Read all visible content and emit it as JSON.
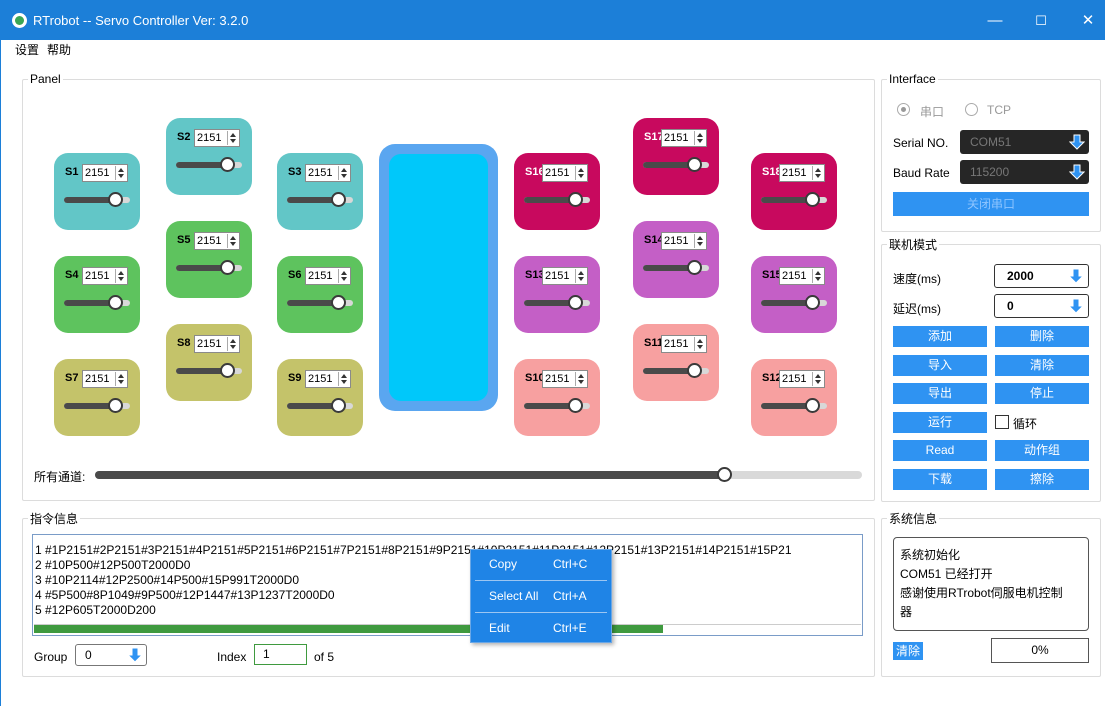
{
  "window": {
    "title": "RTrobot -- Servo Controller  Ver: 3.2.0",
    "minimize": "—",
    "maximize": "☐",
    "close": "✕"
  },
  "menu": {
    "items": [
      "设置",
      "帮助"
    ]
  },
  "panel": {
    "legend": "Panel",
    "all_channels_label": "所有通道:",
    "all_channels_value": 0.82,
    "servos": [
      {
        "id": "S1",
        "value": "2151",
        "color": "#62c6c7",
        "level": 0.78
      },
      {
        "id": "S2",
        "value": "2151",
        "color": "#62c6c7",
        "level": 0.78
      },
      {
        "id": "S3",
        "value": "2151",
        "color": "#62c6c7",
        "level": 0.78
      },
      {
        "id": "S4",
        "value": "2151",
        "color": "#5ec35e",
        "level": 0.78
      },
      {
        "id": "S5",
        "value": "2151",
        "color": "#5ec35e",
        "level": 0.78
      },
      {
        "id": "S6",
        "value": "2151",
        "color": "#5ec35e",
        "level": 0.78
      },
      {
        "id": "S7",
        "value": "2151",
        "color": "#c4c36a",
        "level": 0.78
      },
      {
        "id": "S8",
        "value": "2151",
        "color": "#c4c36a",
        "level": 0.78
      },
      {
        "id": "S9",
        "value": "2151",
        "color": "#c4c36a",
        "level": 0.78
      },
      {
        "id": "S10",
        "value": "2151",
        "color": "#f7a0a0",
        "level": 0.78
      },
      {
        "id": "S11",
        "value": "2151",
        "color": "#f7a0a0",
        "level": 0.78
      },
      {
        "id": "S12",
        "value": "2151",
        "color": "#f7a0a0",
        "level": 0.78
      },
      {
        "id": "S13",
        "value": "2151",
        "color": "#c45fc6",
        "level": 0.78
      },
      {
        "id": "S14",
        "value": "2151",
        "color": "#c45fc6",
        "level": 0.78
      },
      {
        "id": "S15",
        "value": "2151",
        "color": "#c45fc6",
        "level": 0.78
      },
      {
        "id": "S16",
        "value": "2151",
        "color": "#c8095e",
        "level": 0.78
      },
      {
        "id": "S17",
        "value": "2151",
        "color": "#c8095e",
        "level": 0.78
      },
      {
        "id": "S18",
        "value": "2151",
        "color": "#c8095e",
        "level": 0.78
      }
    ]
  },
  "interface": {
    "legend": "Interface",
    "radio_serial": "串口",
    "radio_tcp": "TCP",
    "serial_no_label": "Serial NO.",
    "serial_no_value": "COM51",
    "baud_label": "Baud Rate",
    "baud_value": "115200",
    "close_port": "关闭串口"
  },
  "linkage": {
    "legend": "联机模式",
    "speed_label": "速度(ms)",
    "speed_value": "2000",
    "delay_label": "延迟(ms)",
    "delay_value": "0",
    "buttons": {
      "add": "添加",
      "delete": "删除",
      "import": "导入",
      "clear": "清除",
      "export": "导出",
      "stop": "停止",
      "run": "运行",
      "loop": "循环",
      "read": "Read",
      "action_group": "动作组",
      "download": "下载",
      "erase": "擦除"
    }
  },
  "commands": {
    "legend": "指令信息",
    "lines": [
      "1 #1P2151#2P2151#3P2151#4P2151#5P2151#6P2151#7P2151#8P2151#9P2151#10P2151#11P2151#12P2151#13P2151#14P2151#15P21",
      "2 #10P500#12P500T2000D0",
      "3 #10P2114#12P2500#14P500#15P991T2000D0",
      "4 #5P500#8P1049#9P500#12P1447#13P1237T2000D0",
      "5 #12P605T2000D200"
    ],
    "progress": 0.76,
    "group_label": "Group",
    "group_value": "0",
    "index_label": "Index",
    "index_value": "1",
    "of_label": "of 5"
  },
  "context_menu": [
    {
      "label": "Copy",
      "shortcut": "Ctrl+C"
    },
    {
      "label": "Select All",
      "shortcut": "Ctrl+A"
    },
    {
      "label": "Edit",
      "shortcut": "Ctrl+E"
    }
  ],
  "system": {
    "legend": "系统信息",
    "messages": [
      "系统初始化",
      "COM51 已经打开",
      "感谢使用RTrobot伺服电机控制",
      "器"
    ],
    "clear": "清除",
    "percent": "0%"
  },
  "colors": {
    "titlebar": "#1c7fd8",
    "button": "#2f93f2",
    "center_outer": "#5aa6f0",
    "center_inner": "#00c8fa"
  }
}
